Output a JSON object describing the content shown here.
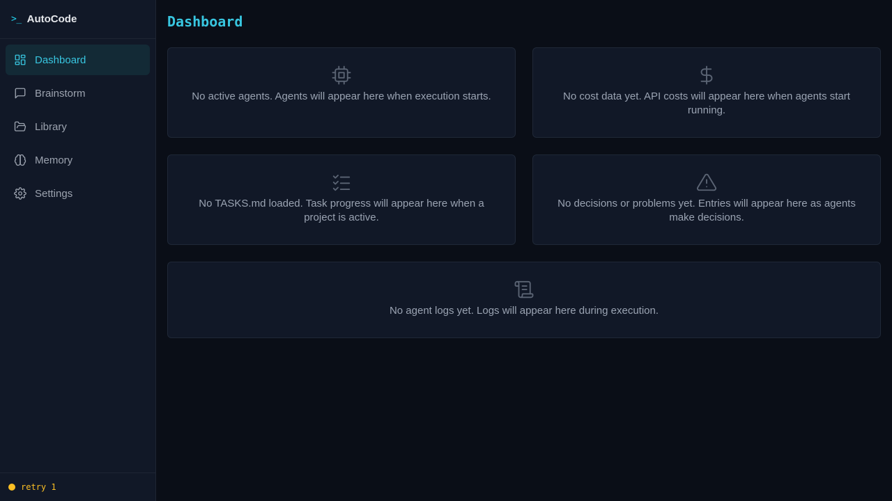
{
  "brand": {
    "prompt": ">_",
    "name": "AutoCode"
  },
  "nav": [
    {
      "label": "Dashboard",
      "icon": "dashboard-icon",
      "active": true
    },
    {
      "label": "Brainstorm",
      "icon": "chat-icon"
    },
    {
      "label": "Library",
      "icon": "folder-icon"
    },
    {
      "label": "Memory",
      "icon": "brain-icon"
    },
    {
      "label": "Settings",
      "icon": "gear-icon"
    }
  ],
  "status": {
    "text": "retry 1",
    "color": "#fbbf24"
  },
  "page": {
    "title": "Dashboard"
  },
  "cards": {
    "agents": {
      "icon": "cpu-icon",
      "text": "No active agents. Agents will appear here when execution starts."
    },
    "costs": {
      "icon": "dollar-icon",
      "text": "No cost data yet. API costs will appear here when agents start running."
    },
    "tasks": {
      "icon": "checklist-icon",
      "text": "No TASKS.md loaded. Task progress will appear here when a project is active."
    },
    "decisions": {
      "icon": "warning-icon",
      "text": "No decisions or problems yet. Entries will appear here as agents make decisions."
    },
    "logs": {
      "icon": "scroll-icon",
      "text": "No agent logs yet. Logs will appear here during execution."
    }
  },
  "colors": {
    "accent": "#38c6e0",
    "sidebar_bg": "#111827",
    "page_bg": "#0a0e17",
    "warning": "#fbbf24"
  }
}
